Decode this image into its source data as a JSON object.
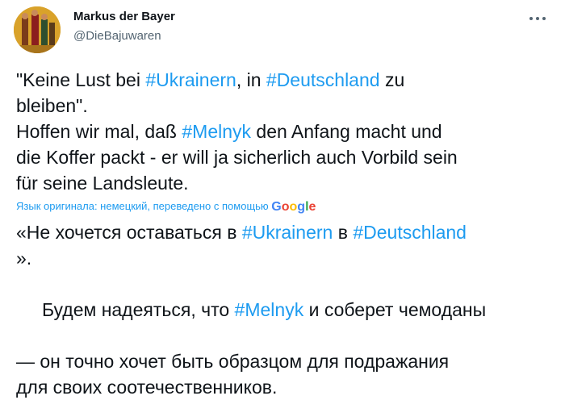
{
  "author": {
    "name": "Markus der Bayer",
    "handle": "@DieBajuwaren",
    "avatar_icon": "profile-photo"
  },
  "more_icon": "more-options-icon",
  "original_tweet": {
    "line1": {
      "t1": "\"Keine Lust bei ",
      "tag1": "#Ukrainern",
      "t2": ", in ",
      "tag2": "#Deutschland",
      "t3": " zu"
    },
    "line2": {
      "t1": "bleiben\"."
    },
    "line3": {
      "t1": "Hoffen wir mal, daß ",
      "tag1": "#Melnyk",
      "t2": " den Anfang macht und"
    },
    "line4": {
      "t1": "die Koffer packt - er will ja sicherlich auch Vorbild sein"
    },
    "line5": {
      "t1": "für seine Landsleute."
    }
  },
  "translation_note": {
    "text": "Язык оригинала: немецкий, переведено с помощью ",
    "logo": {
      "g1": "G",
      "o1": "o",
      "o2": "o",
      "g2": "g",
      "l": "l",
      "e": "e"
    }
  },
  "translated_tweet": {
    "line1": {
      "t1": "«Не хочется оставаться в ",
      "tag1": "#Ukrainern",
      "t2": " в ",
      "tag2": "#Deutschland"
    },
    "line2": {
      "t1": "»."
    },
    "line3": {
      "t1": " Будем надеяться, что ",
      "tag1": "#Melnyk",
      "t2": " и соберет чемоданы"
    },
    "line4": {
      "t1": "— он точно хочет быть образцом для подражания"
    },
    "line5": {
      "t1": "для своих соотечественников."
    }
  },
  "colors": {
    "link": "#1d9bf0",
    "text": "#0f1419",
    "secondary": "#536471"
  }
}
